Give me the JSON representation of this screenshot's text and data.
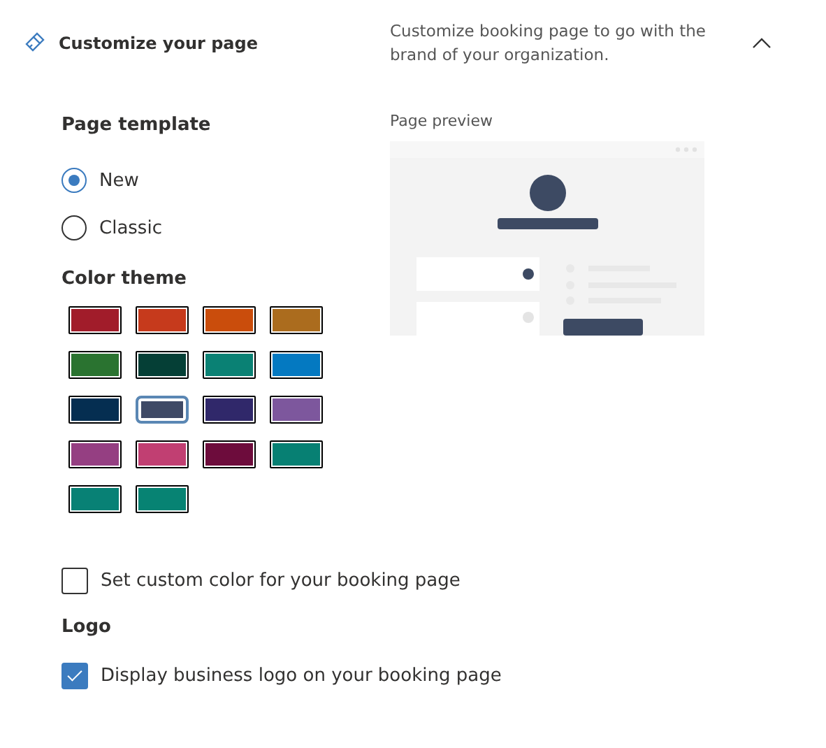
{
  "header": {
    "title": "Customize your page",
    "description": "Customize booking page to go with the brand of your organization.",
    "expanded": true
  },
  "page_template": {
    "heading": "Page template",
    "options": [
      {
        "label": "New",
        "selected": true
      },
      {
        "label": "Classic",
        "selected": false
      }
    ]
  },
  "color_theme": {
    "heading": "Color theme",
    "swatches": [
      {
        "color": "#a11c2a",
        "selected": false
      },
      {
        "color": "#c63a1c",
        "selected": false
      },
      {
        "color": "#ca4d0c",
        "selected": false
      },
      {
        "color": "#ab6c1e",
        "selected": false
      },
      {
        "color": "#2a7330",
        "selected": false
      },
      {
        "color": "#053f36",
        "selected": false
      },
      {
        "color": "#0a8174",
        "selected": false
      },
      {
        "color": "#0479c1",
        "selected": false
      },
      {
        "color": "#052e51",
        "selected": false
      },
      {
        "color": "#3f4a66",
        "selected": true
      },
      {
        "color": "#30286a",
        "selected": false
      },
      {
        "color": "#7d579d",
        "selected": false
      },
      {
        "color": "#953f82",
        "selected": false
      },
      {
        "color": "#c13f72",
        "selected": false
      },
      {
        "color": "#6d0c3c",
        "selected": false
      },
      {
        "color": "#078073",
        "selected": false
      },
      {
        "color": "#088175",
        "selected": false
      },
      {
        "color": "#078373",
        "selected": false
      }
    ]
  },
  "preview": {
    "label": "Page preview"
  },
  "custom_color": {
    "label": "Set custom color for your booking page",
    "checked": false
  },
  "logo": {
    "heading": "Logo",
    "label": "Display business logo on your booking page",
    "checked": true
  }
}
